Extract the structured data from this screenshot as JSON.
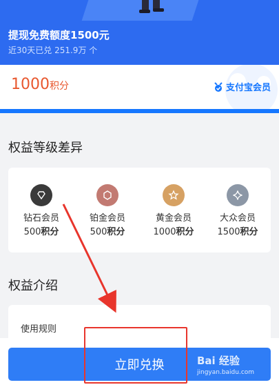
{
  "header": {
    "title": "提现免费额度1500元",
    "subtitle": "近30天已兑 251.9万 个"
  },
  "points": {
    "value": "1000",
    "unit": "积分",
    "brand": "支付宝会员"
  },
  "sections": {
    "levels_title": "权益等级差异",
    "intro_title": "权益介绍"
  },
  "levels": [
    {
      "name": "钻石会员",
      "points_num": "500",
      "points_unit": "积分",
      "icon": "diamond-icon",
      "color": "#3a3a3a"
    },
    {
      "name": "铂金会员",
      "points_num": "500",
      "points_unit": "积分",
      "icon": "hexagon-icon",
      "color": "#c27a72"
    },
    {
      "name": "黄金会员",
      "points_num": "1000",
      "points_unit": "积分",
      "icon": "star-icon",
      "color": "#d6a163"
    },
    {
      "name": "大众会员",
      "points_num": "1500",
      "points_unit": "积分",
      "icon": "sparkle-icon",
      "color": "#8c97a6"
    }
  ],
  "intro": {
    "rules_label": "使用规则"
  },
  "actions": {
    "redeem_label": "立即兑换"
  },
  "watermark": {
    "brand": "Bai 经验",
    "url": "jingyan.baidu.com"
  },
  "colors": {
    "header_blue": "#2d6bf0",
    "accent_blue": "#1677ff",
    "points_orange": "#e8572e",
    "button_blue": "#2f7df6",
    "annotation_red": "#e8352c"
  }
}
